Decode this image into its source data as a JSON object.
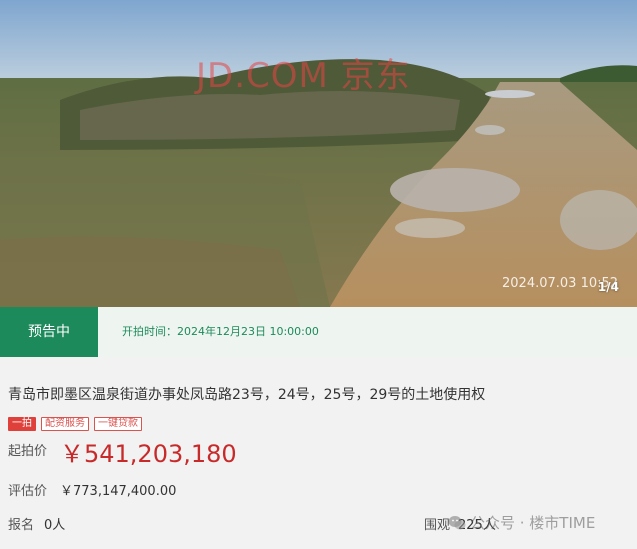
{
  "photo": {
    "watermark": "JD.COM 京东",
    "date_stamp": "2024.07.03   10:52",
    "counter": "1/4"
  },
  "status": {
    "badge": "预告中",
    "start_time": "开拍时间：2024年12月23日 10:00:00"
  },
  "lot": {
    "title": "青岛市即墨区温泉街道办事处凤岛路23号，24号，25号，29号的土地使用权",
    "tags": [
      "一拍",
      "配资服务",
      "一键贷款"
    ],
    "start_price_label": "起拍价",
    "start_price": "￥541,203,180",
    "appraisal_label": "评估价",
    "appraisal_value": "￥773,147,400.00",
    "signup_label": "报名",
    "signup_value": "0人",
    "views_label": "围观",
    "views_value": "225人"
  },
  "account_watermark": {
    "text": "公众号 · 楼市TIME",
    "icon": "wechat-icon"
  },
  "colors": {
    "status_green": "#1d8a5b",
    "price_red": "#c82a2a",
    "tag_red": "#e0403a"
  }
}
